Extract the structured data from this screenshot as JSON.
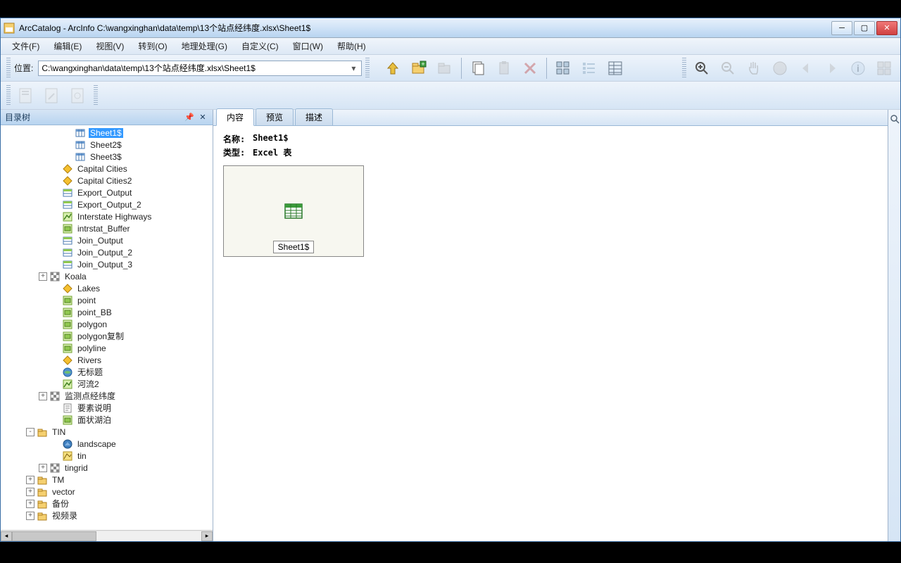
{
  "window": {
    "title": "ArcCatalog - ArcInfo  C:\\wangxinghan\\data\\temp\\13个站点经纬度.xlsx\\Sheet1$"
  },
  "menu": {
    "file": "文件(F)",
    "edit": "编辑(E)",
    "view": "视图(V)",
    "goto": "转到(O)",
    "geoprocessing": "地理处理(G)",
    "customize": "自定义(C)",
    "window": "窗口(W)",
    "help": "帮助(H)"
  },
  "location": {
    "label": "位置:",
    "value": "C:\\wangxinghan\\data\\temp\\13个站点经纬度.xlsx\\Sheet1$"
  },
  "tree_panel": {
    "title": "目录树"
  },
  "tree": [
    {
      "indent": 5,
      "icon": "table",
      "label": "Sheet1$",
      "selected": true
    },
    {
      "indent": 5,
      "icon": "table",
      "label": "Sheet2$"
    },
    {
      "indent": 5,
      "icon": "table",
      "label": "Sheet3$"
    },
    {
      "indent": 4,
      "icon": "point-shp",
      "label": "Capital Cities"
    },
    {
      "indent": 4,
      "icon": "point-shp",
      "label": "Capital Cities2"
    },
    {
      "indent": 4,
      "icon": "dbf",
      "label": "Export_Output"
    },
    {
      "indent": 4,
      "icon": "dbf",
      "label": "Export_Output_2"
    },
    {
      "indent": 4,
      "icon": "line-shp",
      "label": "Interstate Highways"
    },
    {
      "indent": 4,
      "icon": "poly-shp",
      "label": "intrstat_Buffer"
    },
    {
      "indent": 4,
      "icon": "dbf",
      "label": "Join_Output"
    },
    {
      "indent": 4,
      "icon": "dbf",
      "label": "Join_Output_2"
    },
    {
      "indent": 4,
      "icon": "dbf",
      "label": "Join_Output_3"
    },
    {
      "indent": 3,
      "expander": "+",
      "icon": "raster",
      "label": "Koala"
    },
    {
      "indent": 4,
      "icon": "point-shp",
      "label": "Lakes"
    },
    {
      "indent": 4,
      "icon": "poly-shp",
      "label": "point"
    },
    {
      "indent": 4,
      "icon": "poly-shp",
      "label": "point_BB"
    },
    {
      "indent": 4,
      "icon": "poly-shp",
      "label": "polygon"
    },
    {
      "indent": 4,
      "icon": "poly-shp",
      "label": "polygon复制"
    },
    {
      "indent": 4,
      "icon": "poly-shp",
      "label": "polyline"
    },
    {
      "indent": 4,
      "icon": "point-shp",
      "label": "Rivers"
    },
    {
      "indent": 4,
      "icon": "globe",
      "label": "无标题"
    },
    {
      "indent": 4,
      "icon": "line-shp",
      "label": "河流2"
    },
    {
      "indent": 3,
      "expander": "+",
      "icon": "raster",
      "label": "监测点经纬度"
    },
    {
      "indent": 4,
      "icon": "text",
      "label": "要素说明"
    },
    {
      "indent": 4,
      "icon": "poly-shp",
      "label": "面状湖泊"
    },
    {
      "indent": 2,
      "expander": "-",
      "icon": "folder",
      "label": "TIN"
    },
    {
      "indent": 4,
      "icon": "tin",
      "label": "landscape"
    },
    {
      "indent": 4,
      "icon": "tin2",
      "label": "tin"
    },
    {
      "indent": 3,
      "expander": "+",
      "icon": "raster",
      "label": "tingrid"
    },
    {
      "indent": 2,
      "expander": "+",
      "icon": "folder",
      "label": "TM"
    },
    {
      "indent": 2,
      "expander": "+",
      "icon": "folder",
      "label": "vector"
    },
    {
      "indent": 2,
      "expander": "+",
      "icon": "folder",
      "label": "备份"
    },
    {
      "indent": 2,
      "expander": "+",
      "icon": "folder",
      "label": "视频录"
    }
  ],
  "tabs": {
    "content": "内容",
    "preview": "预览",
    "description": "描述"
  },
  "details": {
    "name_label": "名称:",
    "name_value": "Sheet1$",
    "type_label": "类型:",
    "type_value": "Excel 表",
    "thumb_label": "Sheet1$"
  }
}
